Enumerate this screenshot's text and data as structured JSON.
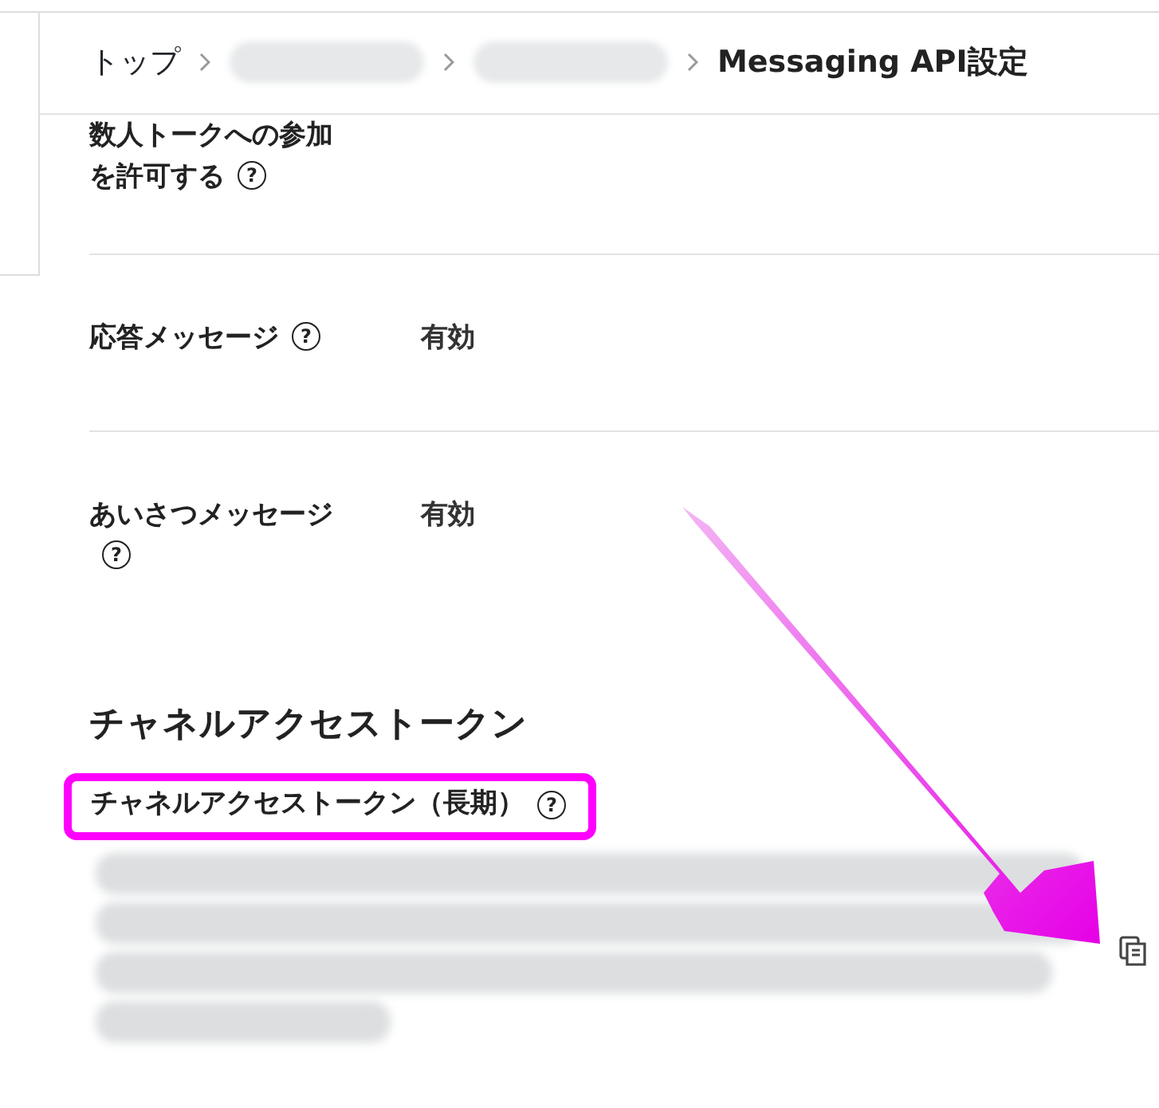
{
  "breadcrumbs": [
    {
      "kind": "text",
      "label": "トップ"
    },
    {
      "kind": "redacted"
    },
    {
      "kind": "redacted"
    },
    {
      "kind": "current",
      "label": "Messaging API設定"
    }
  ],
  "settings": [
    {
      "label": "数人トークへの参加を許可する",
      "help": "?"
    },
    {
      "label": "応答メッセージ",
      "help": "?",
      "value": "有効"
    },
    {
      "label": "あいさつメッセージ",
      "help": "?",
      "value": "有効"
    }
  ],
  "token_section": {
    "title": "チャネルアクセストークン",
    "field_label": "チャネルアクセストークン（長期）",
    "help": "?",
    "value_redacted": true,
    "highlighted": true,
    "arrow": true
  }
}
